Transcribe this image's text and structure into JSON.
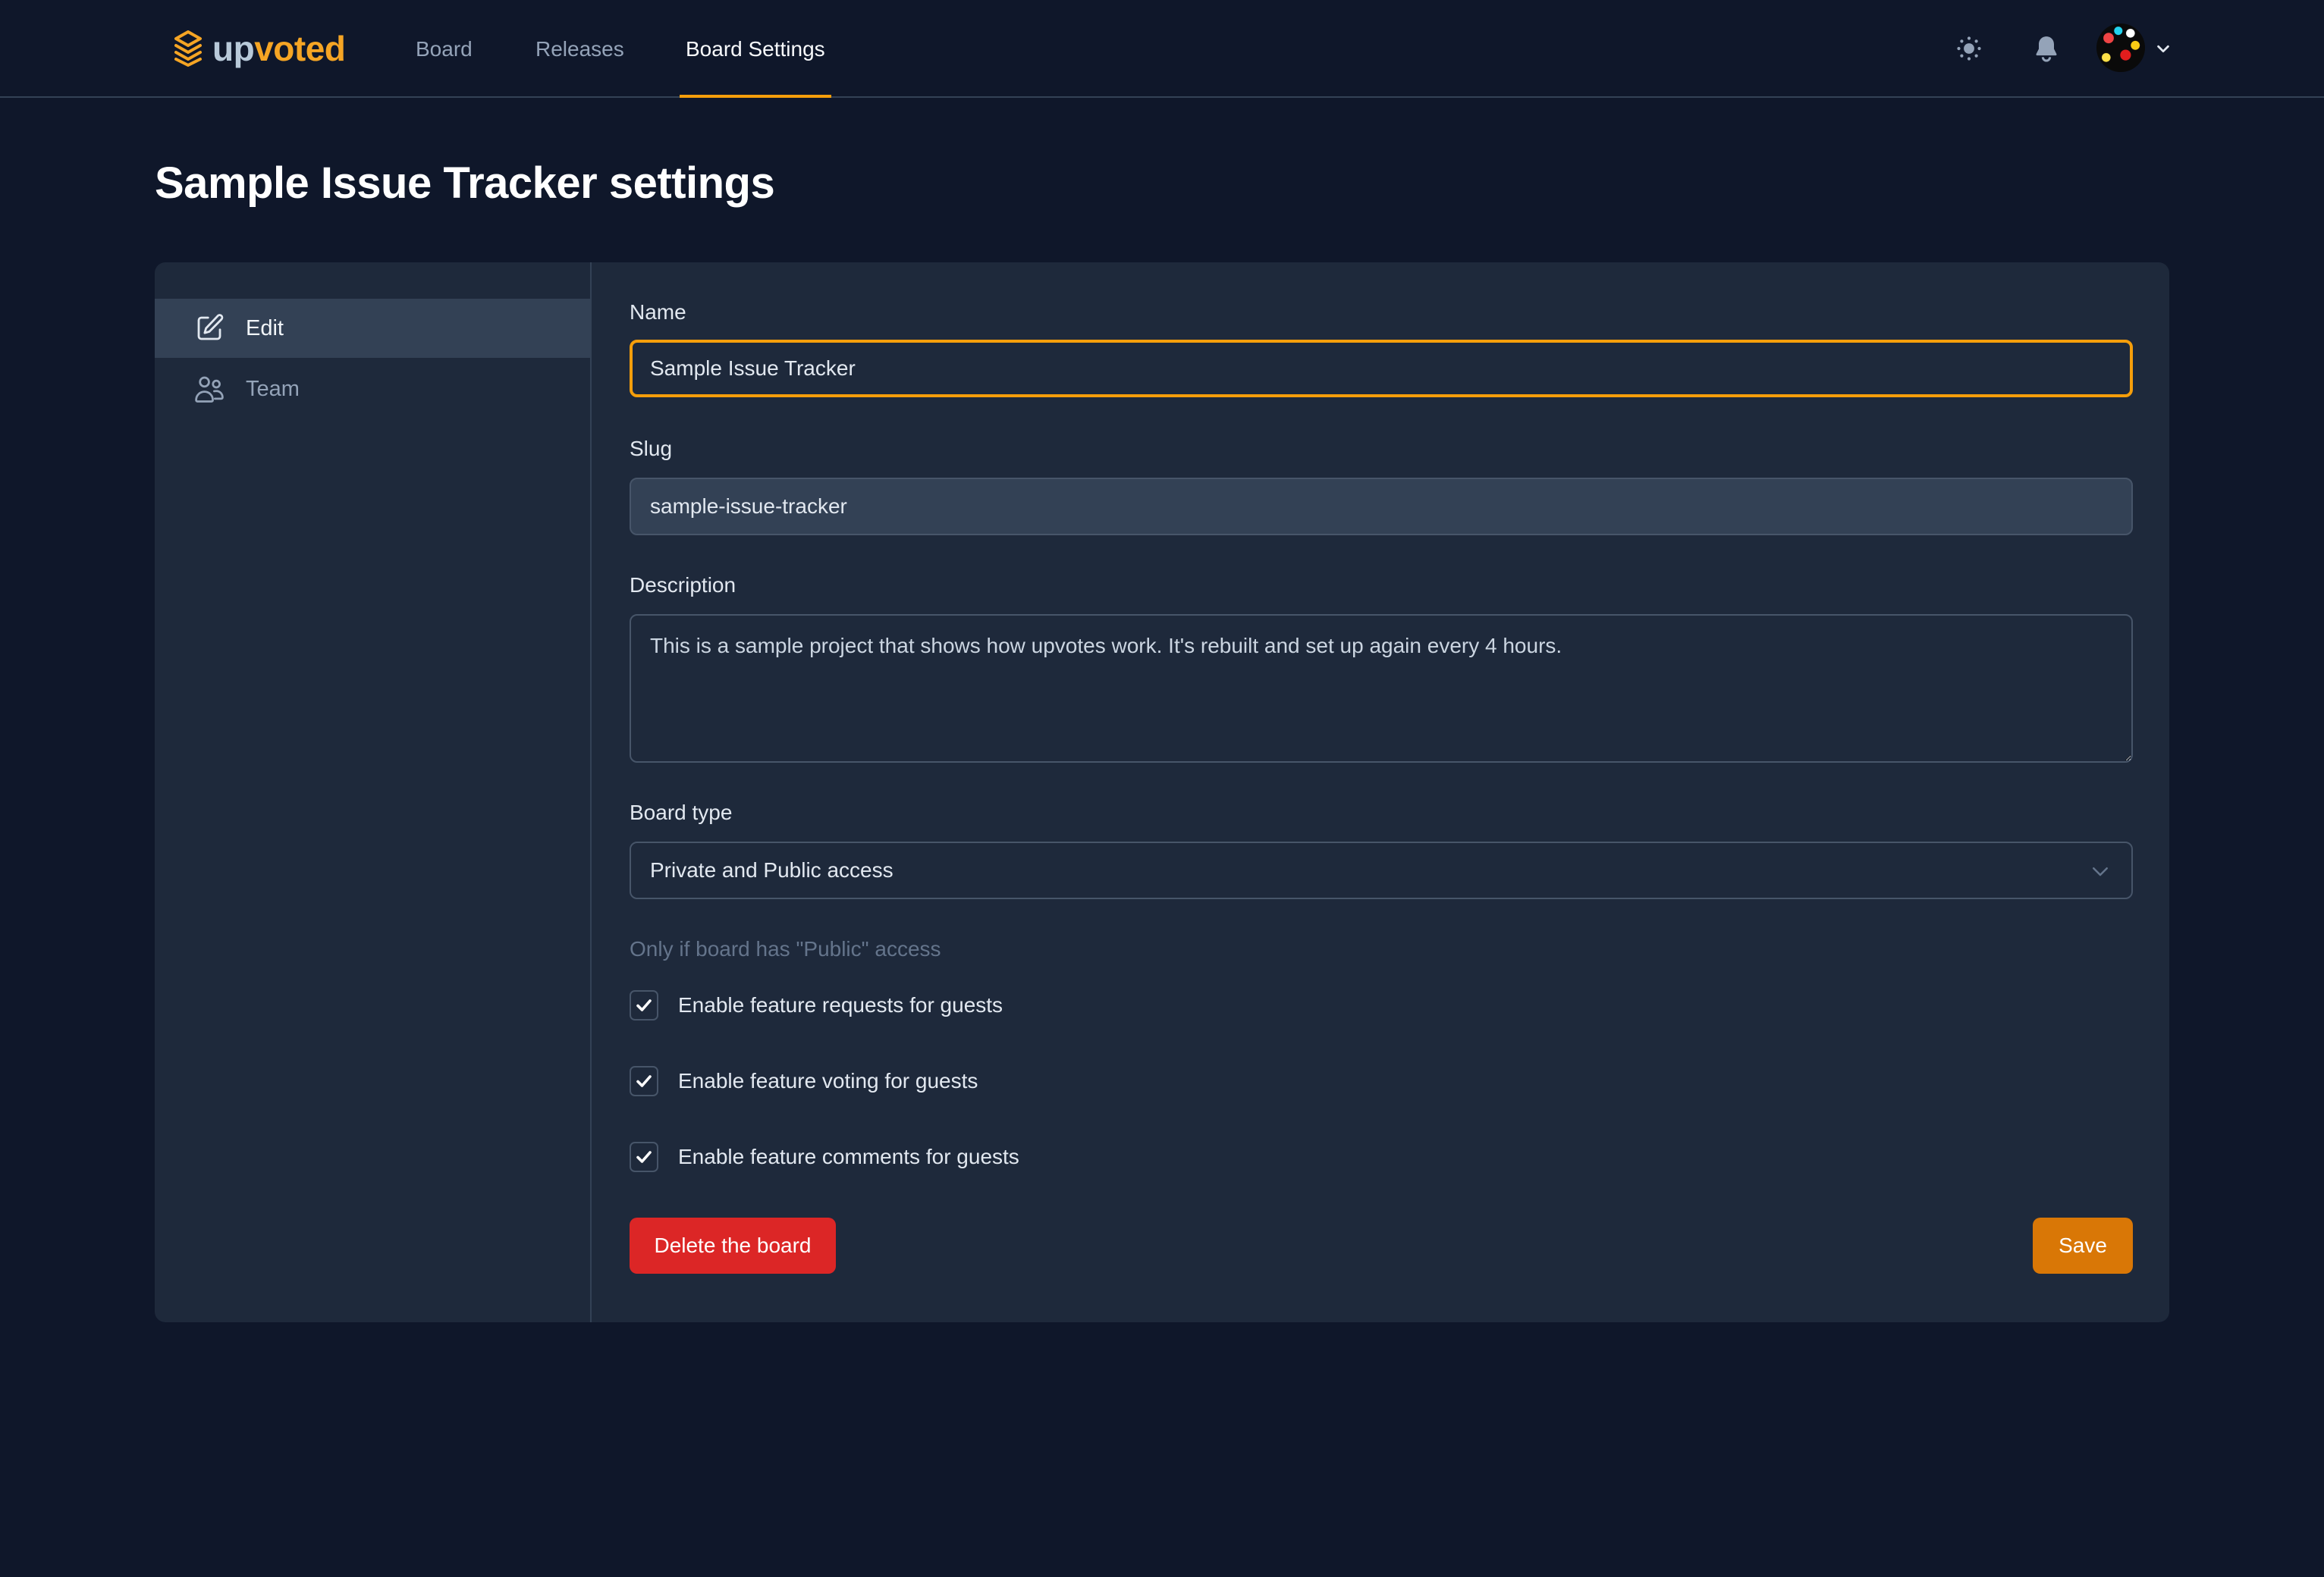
{
  "app": {
    "logo": {
      "part1": "up",
      "part2": "voted",
      "icon": "layers-icon"
    },
    "brand_colors": {
      "accent": "#f59e0b",
      "logo_light": "#b8c9d9",
      "danger": "#dc2626",
      "save": "#d97706"
    }
  },
  "nav": {
    "items": [
      {
        "label": "Board",
        "active": false
      },
      {
        "label": "Releases",
        "active": false
      },
      {
        "label": "Board Settings",
        "active": true
      }
    ]
  },
  "header_actions": {
    "theme_toggle_icon": "sun-icon",
    "notifications_icon": "bell-icon",
    "avatar_menu_icon": "chevron-down-icon"
  },
  "page": {
    "title": "Sample Issue Tracker settings"
  },
  "sidebar": {
    "items": [
      {
        "label": "Edit",
        "icon": "pencil-square-icon",
        "active": true
      },
      {
        "label": "Team",
        "icon": "users-icon",
        "active": false
      }
    ]
  },
  "form": {
    "name": {
      "label": "Name",
      "value": "Sample Issue Tracker"
    },
    "slug": {
      "label": "Slug",
      "value": "sample-issue-tracker"
    },
    "description": {
      "label": "Description",
      "value": "This is a sample project that shows how upvotes work. It's rebuilt and set up again every 4 hours."
    },
    "board_type": {
      "label": "Board type",
      "selected": "Private and Public access"
    },
    "public_hint": "Only if board has \"Public\" access",
    "checkboxes": [
      {
        "label": "Enable feature requests for guests",
        "checked": true
      },
      {
        "label": "Enable feature voting for guests",
        "checked": true
      },
      {
        "label": "Enable feature comments for guests",
        "checked": true
      }
    ],
    "delete_label": "Delete the board",
    "save_label": "Save"
  }
}
